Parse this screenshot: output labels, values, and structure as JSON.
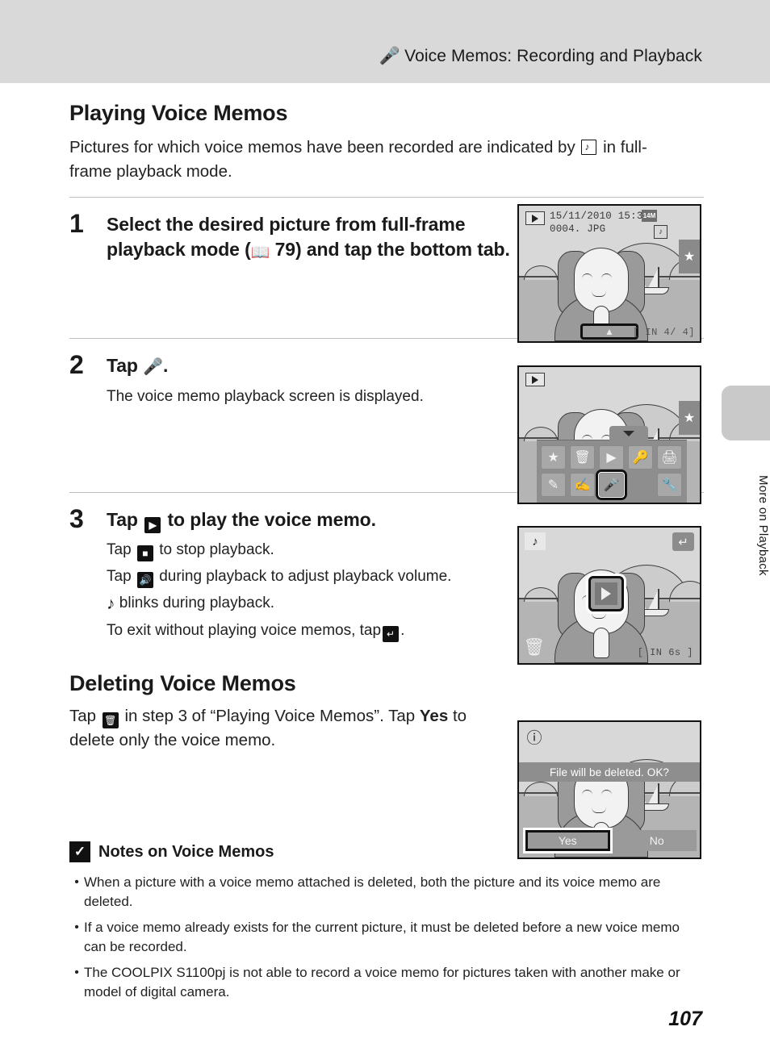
{
  "header": {
    "icon": "microphone-icon",
    "title": "Voice Memos: Recording and Playback"
  },
  "side_tab": {
    "label": "More on Playback"
  },
  "sections": {
    "playing": {
      "heading": "Playing Voice Memos",
      "intro_before": "Pictures for which voice memos have been recorded are indicated by",
      "intro_icon": "voice-memo-indicator-icon",
      "intro_after": "in full-frame playback mode."
    },
    "deleting": {
      "heading": "Deleting Voice Memos",
      "text_1": "Tap",
      "icon": "trash-icon",
      "text_2": "in step 3 of “Playing Voice Memos”. Tap",
      "bold_word": "Yes",
      "text_3": "to delete only the voice memo."
    }
  },
  "steps": [
    {
      "number": "1",
      "heading_1": "Select the desired picture from full-frame playback mode (",
      "book_icon": "book-reference-icon",
      "page_ref": "79",
      "heading_2": ") and tap the bottom tab."
    },
    {
      "number": "2",
      "heading_1": "Tap",
      "mic_icon": "microphone-icon",
      "heading_2": ".",
      "sub_1": "The voice memo playback screen is displayed."
    },
    {
      "number": "3",
      "heading_1": "Tap",
      "play_icon": "play-icon",
      "heading_2": "to play the voice memo.",
      "sub_lines": [
        {
          "before": "Tap",
          "icon": "stop-icon",
          "after": "to stop playback."
        },
        {
          "before": "Tap",
          "icon": "volume-icon",
          "after": "during playback to adjust playback volume."
        },
        {
          "before": "",
          "icon": "music-note-icon",
          "after": "blinks during playback."
        },
        {
          "before": "To exit without playing voice memos, tap",
          "icon": "return-icon",
          "after": "."
        }
      ]
    }
  ],
  "screens": {
    "screen1": {
      "playback_badge": "playback-mode-icon",
      "date": "15/11/2010  15:30",
      "filename": "0004. JPG",
      "size_badge": "14M",
      "memo_badge": "voice-memo-icon",
      "star_tab": "★",
      "bottom_tab": "▲",
      "frame_counter": "[ IN    4/    4]"
    },
    "screen2": {
      "playback_badge": "playback-mode-icon",
      "star_tab": "★",
      "menu_row1": [
        "favorites-icon",
        "delete-icon",
        "slideshow-icon",
        "protect-key-icon",
        "print-order-icon"
      ],
      "menu_row2": [
        "paint-icon",
        "edit-icon",
        "voice-memo-icon",
        "",
        "setup-wrench-icon"
      ],
      "selected_icon": "voice-memo-icon"
    },
    "screen3": {
      "note_chip": "music-note-icon",
      "return_chip": "return-icon",
      "center_button": "play-icon",
      "trash": "trash-icon",
      "duration": "[ IN   6s ]"
    },
    "screen4": {
      "warning_icon": "warning-icon",
      "message": "File will be deleted. OK?",
      "yes_label": "Yes",
      "no_label": "No",
      "selected": "Yes"
    }
  },
  "notes": {
    "icon": "checkmark-warning-icon",
    "title": "Notes on Voice Memos",
    "items": [
      "When a picture with a voice memo attached is deleted, both the picture and its voice memo are deleted.",
      "If a voice memo already exists for the current picture, it must be deleted before a new voice memo can be recorded.",
      "The COOLPIX S1100pj is not able to record a voice memo for pictures taken with another make or model of digital camera."
    ],
    "bullet": "•"
  },
  "page_number": "107"
}
